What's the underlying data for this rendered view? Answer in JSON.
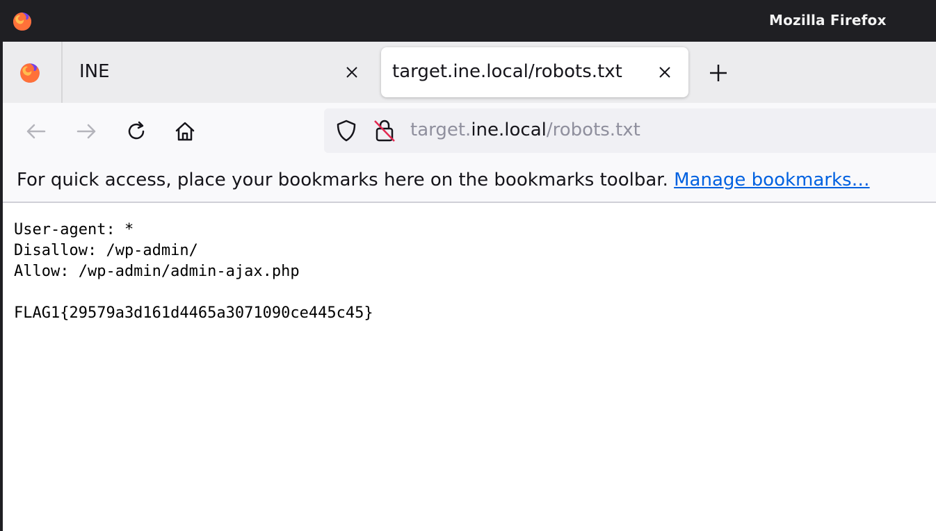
{
  "window": {
    "title": "Mozilla Firefox"
  },
  "tabs": [
    {
      "label": "INE",
      "active": false
    },
    {
      "label": "target.ine.local/robots.txt",
      "active": true
    }
  ],
  "urlbar": {
    "prefix": "target.",
    "domain": "ine.local",
    "path": "/robots.txt"
  },
  "bookmarks_toolbar": {
    "message": "For quick access, place your bookmarks here on the bookmarks toolbar.",
    "link": "Manage bookmarks…"
  },
  "page": {
    "lines": [
      "User-agent: *",
      "Disallow: /wp-admin/",
      "Allow: /wp-admin/admin-ajax.php",
      "",
      "FLAG1{29579a3d161d4465a3071090ce445c45}"
    ]
  },
  "colors": {
    "titlebar": "#1f1f23",
    "tabstrip": "#ececee",
    "toolbar": "#f9f9fb",
    "link": "#0061e0"
  }
}
